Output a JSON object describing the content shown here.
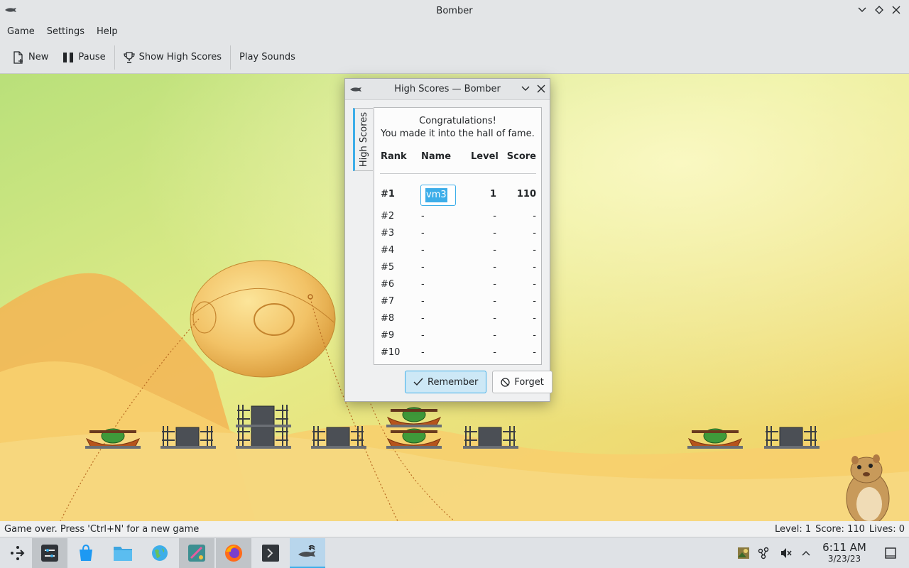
{
  "window": {
    "title": "Bomber"
  },
  "menu": {
    "items": [
      "Game",
      "Settings",
      "Help"
    ]
  },
  "toolbar": {
    "new_label": "New",
    "pause_label": "Pause",
    "highscores_label": "Show High Scores",
    "sounds_label": "Play Sounds"
  },
  "dialog": {
    "title": "High Scores — Bomber",
    "tab_label": "High Scores",
    "congrats_line1": "Congratulations!",
    "congrats_line2": "You made it into the hall of fame.",
    "headers": {
      "rank": "Rank",
      "name": "Name",
      "level": "Level",
      "score": "Score"
    },
    "rows": [
      {
        "rank": "#1",
        "name": "vm3",
        "level": "1",
        "score": "110"
      },
      {
        "rank": "#2",
        "name": "-",
        "level": "-",
        "score": "-"
      },
      {
        "rank": "#3",
        "name": "-",
        "level": "-",
        "score": "-"
      },
      {
        "rank": "#4",
        "name": "-",
        "level": "-",
        "score": "-"
      },
      {
        "rank": "#5",
        "name": "-",
        "level": "-",
        "score": "-"
      },
      {
        "rank": "#6",
        "name": "-",
        "level": "-",
        "score": "-"
      },
      {
        "rank": "#7",
        "name": "-",
        "level": "-",
        "score": "-"
      },
      {
        "rank": "#8",
        "name": "-",
        "level": "-",
        "score": "-"
      },
      {
        "rank": "#9",
        "name": "-",
        "level": "-",
        "score": "-"
      },
      {
        "rank": "#10",
        "name": "-",
        "level": "-",
        "score": "-"
      }
    ],
    "remember_label": "Remember",
    "forget_label": "Forget"
  },
  "status": {
    "message": "Game over. Press 'Ctrl+N' for a new game",
    "level": "Level: 1",
    "score": "Score: 110",
    "lives": "Lives: 0"
  },
  "taskbar": {
    "clock_time": "6:11 AM",
    "clock_date": "3/23/23"
  },
  "colors": {
    "accent": "#3daee9",
    "background": "#eff0f1"
  },
  "icons": [
    "app-menu-icon",
    "system-settings-icon",
    "discover-icon",
    "files-icon",
    "browser-globe-icon",
    "app-icon",
    "firefox-icon",
    "terminal-icon",
    "bomber-icon",
    "tray-image-icon",
    "tray-network-icon",
    "volume-muted-icon",
    "tray-expand-icon",
    "show-desktop-icon"
  ]
}
